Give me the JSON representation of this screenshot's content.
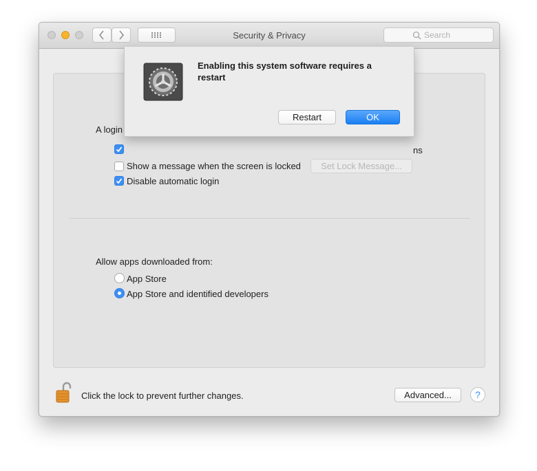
{
  "window": {
    "title": "Security & Privacy"
  },
  "toolbar": {
    "search_placeholder": "Search"
  },
  "general": {
    "login_label_visible": "A login",
    "trailing_label_visible": "ns",
    "checkboxes": [
      {
        "label": "Show a message when the screen is locked",
        "checked": false
      },
      {
        "label": "Disable automatic login",
        "checked": true
      }
    ],
    "set_lock_message_label": "Set Lock Message..."
  },
  "downloads": {
    "heading": "Allow apps downloaded from:",
    "options": [
      {
        "label": "App Store",
        "selected": false
      },
      {
        "label": "App Store and identified developers",
        "selected": true
      }
    ]
  },
  "footer": {
    "lock_text": "Click the lock to prevent further changes.",
    "advanced_label": "Advanced...",
    "help_label": "?"
  },
  "dialog": {
    "message": "Enabling this system software requires a restart",
    "restart_label": "Restart",
    "ok_label": "OK",
    "icon": "gear-icon"
  },
  "colors": {
    "accent": "#3d8ff3",
    "window_bg": "#ececec",
    "panel_bg": "#e3e3e3"
  }
}
